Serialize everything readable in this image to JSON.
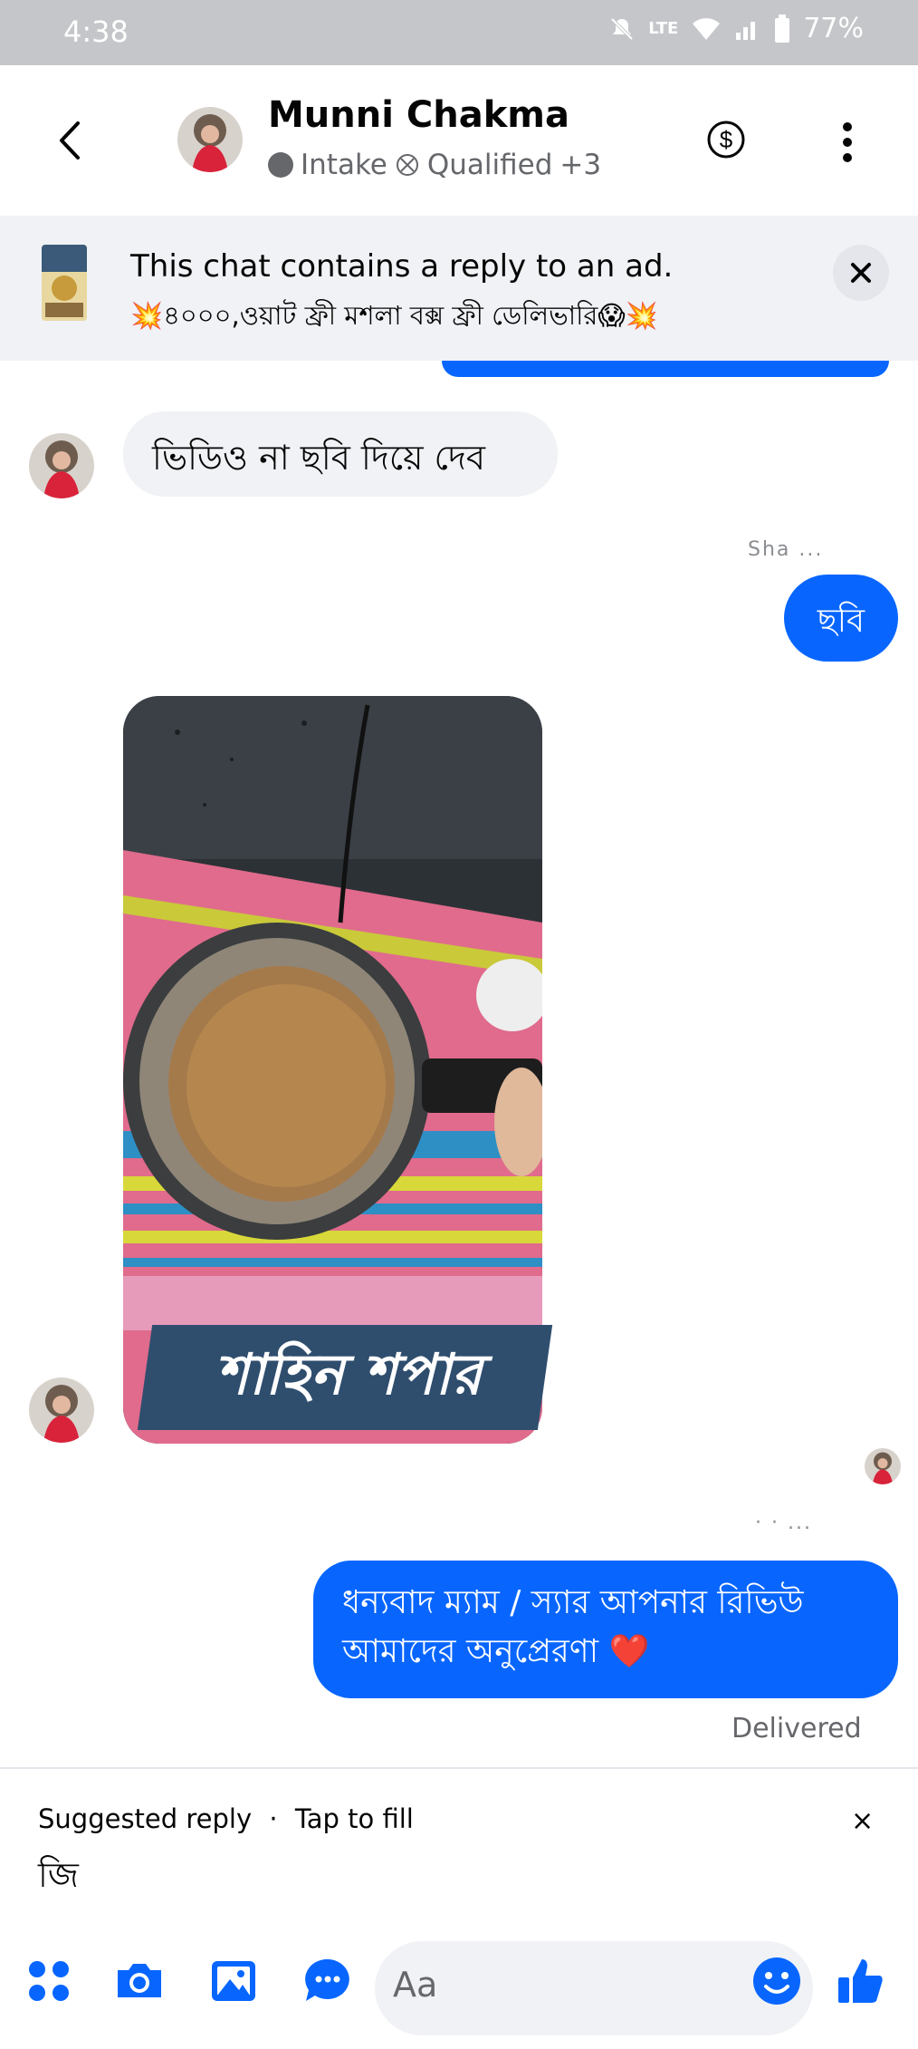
{
  "status_bar": {
    "time": "4:38",
    "network": "LTE",
    "battery": "77%"
  },
  "header": {
    "contact_name": "Munni Chakma",
    "label_primary": "Intake",
    "label_secondary": "Qualified",
    "label_more": "+3",
    "icons": [
      "back-icon",
      "dollar-icon",
      "more-vertical-icon"
    ]
  },
  "ad_banner": {
    "title": "This chat contains a reply to an ad.",
    "subtitle": "💥৪০০০,ওয়াট ফ্রী মশলা বক্স ফ্রী ডেলিভারি😱💥"
  },
  "messages": {
    "incoming_1": "ভিডিও  না ছবি দিয়ে  দেব",
    "seen_label_1": "Sha ...",
    "outgoing_1": "ছবি",
    "photo_caption": "শাহিন শপার",
    "seen_label_2": "· · ...",
    "outgoing_2_line1": "ধন্যবাদ ম্যাম / স্যার আপনার রিভিউ",
    "outgoing_2_line2": "আমাদের অনুপ্রেরণা ❤️",
    "status": "Delivered"
  },
  "suggested_reply": {
    "label": "Suggested reply",
    "separator": "·",
    "action": "Tap to fill",
    "text": "জি",
    "close": "×"
  },
  "composer": {
    "placeholder": "Aa",
    "icons": [
      "apps-icon",
      "camera-icon",
      "gallery-icon",
      "saved-reply-icon",
      "emoji-icon",
      "like-icon"
    ]
  },
  "colors": {
    "accent": "#0866ff",
    "incoming_bg": "#f0f2f5",
    "banner_bg": "#f0f2f5",
    "status_bar": "#c4c6c9",
    "caption_bg": "#2f4e6e"
  }
}
